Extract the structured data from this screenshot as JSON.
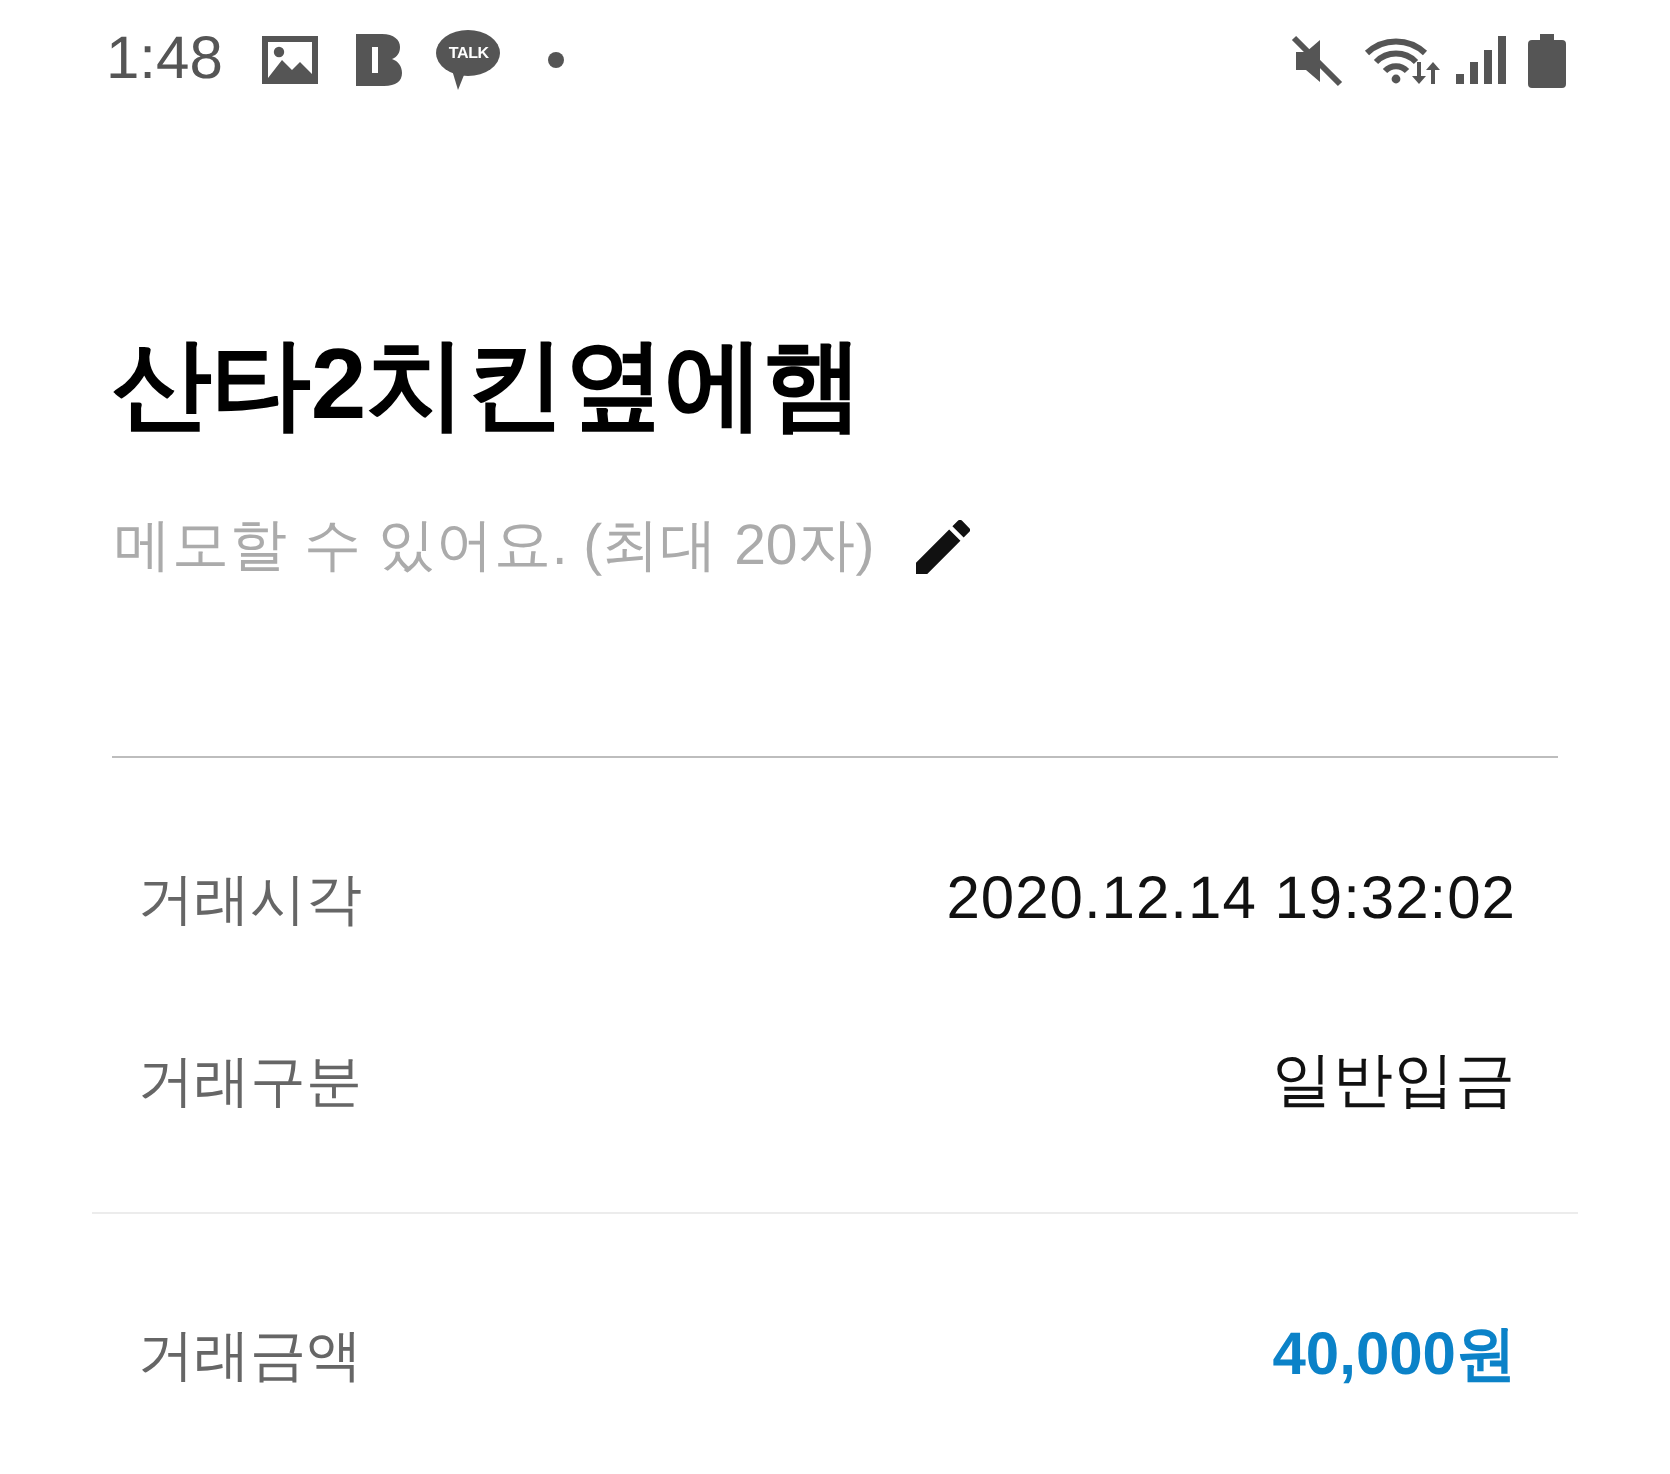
{
  "status_bar": {
    "time": "1:48",
    "chat_badge": "TALK"
  },
  "title": "산타2치킨옆에햄",
  "memo": {
    "placeholder": "메모할 수 있어요. (최대 20자)"
  },
  "sections": [
    {
      "rows": [
        {
          "kind": "text",
          "label": "거래시각",
          "value": "2020.12.14 19:32:02"
        },
        {
          "kind": "text",
          "label": "거래구분",
          "value": "일반입금"
        }
      ]
    },
    {
      "rows": [
        {
          "kind": "amount",
          "label": "거래금액",
          "value": "40,000원"
        }
      ]
    }
  ]
}
